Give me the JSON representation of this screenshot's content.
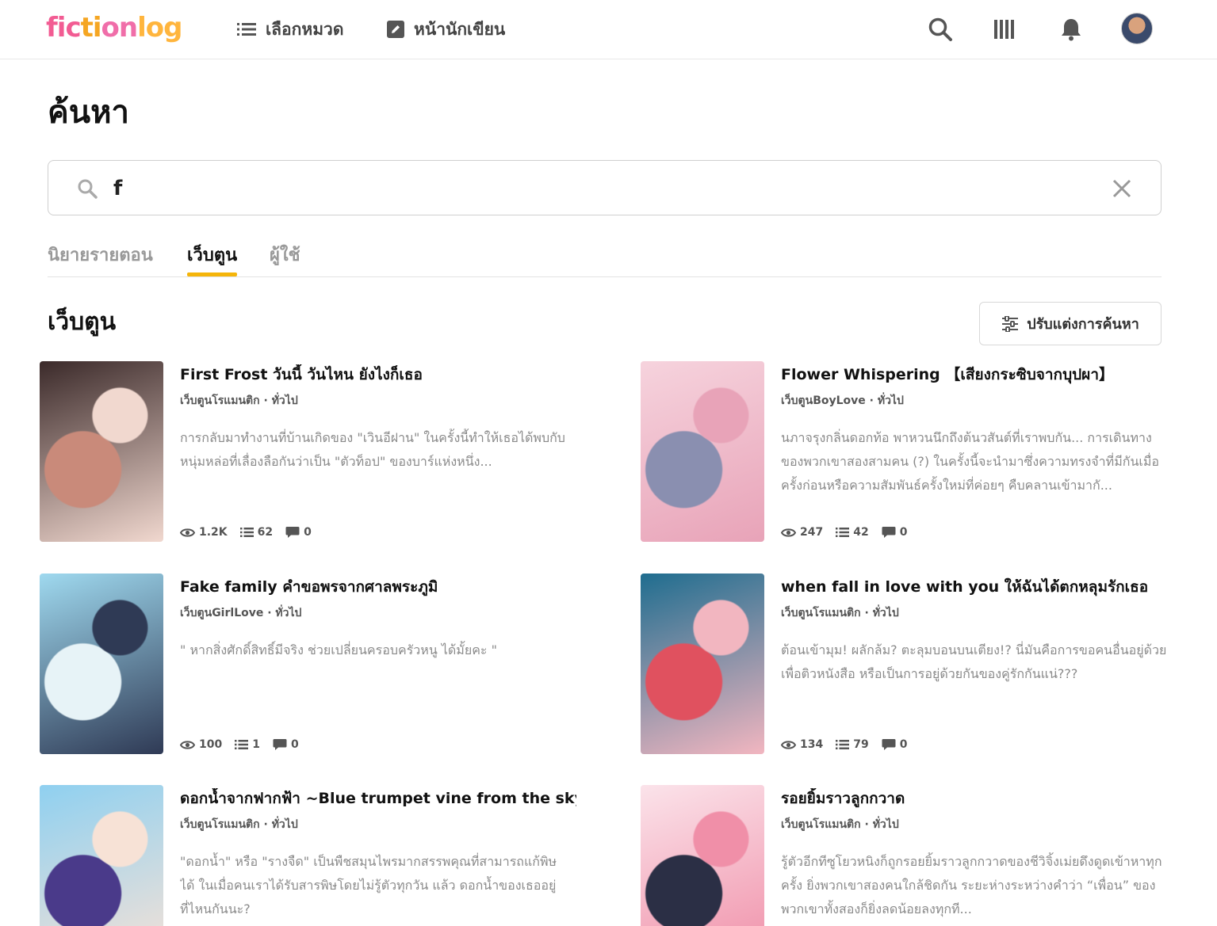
{
  "nav": {
    "logo": "fictionlog",
    "categories_label": "เลือกหมวด",
    "writer_label": "หน้านักเขียน"
  },
  "page": {
    "title": "ค้นหา"
  },
  "search": {
    "value": "f",
    "placeholder": ""
  },
  "tabs": [
    {
      "label": "นิยายรายตอน",
      "active": false
    },
    {
      "label": "เว็บตูน",
      "active": true
    },
    {
      "label": "ผู้ใช้",
      "active": false
    }
  ],
  "section": {
    "title": "เว็บตูน",
    "refine_label": "ปรับแต่งการค้นหา"
  },
  "results": [
    {
      "title": "First Frost วันนี้ วันไหน ยังไงก็เธอ",
      "genre": "เว็บตูนโรแมนติก · ทั่วไป",
      "description": "การกลับมาทำงานที่บ้านเกิดของ \"เวินอีฝาน\" ในครั้งนี้ทำให้เธอได้พบกับหนุ่มหล่อที่เลื่องลือกันว่าเป็น \"ตัวท็อป\" ของบาร์แห่งหนึ่ง...",
      "views": "1.2K",
      "chapters": "62",
      "comments": "0",
      "cover_colors": [
        "#3b2a2a",
        "#c98a7a",
        "#f1d8cf"
      ]
    },
    {
      "title": "Flower Whispering 【เสียงกระซิบจากบุปผา】",
      "genre": "เว็บตูนBoyLove · ทั่วไป",
      "description": "นภาจรุงกลิ่นดอกท้อ พาหวนนึกถึงต้นวสันต์ที่เราพบกัน... การเดินทางของพวกเขาสองสามคน (?) ในครั้งนี้จะนำมาซึ่งความทรงจำที่มีกันเมื่อครั้งก่อนหรือความสัมพันธ์ครั้งใหม่ที่ค่อยๆ คืบคลานเข้ามากั...",
      "views": "247",
      "chapters": "42",
      "comments": "0",
      "cover_colors": [
        "#f6d3dd",
        "#8a8fb0",
        "#e8a3b8"
      ]
    },
    {
      "title": "Fake family คำขอพรจากศาลพระภูมิ",
      "genre": "เว็บตูนGirlLove · ทั่วไป",
      "description": "\" หากสิ่งศักดิ์สิทธิ์มีจริง ช่วยเปลี่ยนครอบครัวหนู ได้มั้ยคะ \"",
      "views": "100",
      "chapters": "1",
      "comments": "0",
      "cover_colors": [
        "#9fd9ef",
        "#e7f3f7",
        "#2f3a55"
      ]
    },
    {
      "title": "when fall in love with you ให้ฉันได้ตกหลุมรักเธอ",
      "genre": "เว็บตูนโรแมนติก · ทั่วไป",
      "description": "ต้อนเข้ามุม! ผลักล้ม? ตะลุมบอนบนเตียง!? นี่มันคือการขอคนอื่นอยู่ด้วยเพื่อติวหนังสือ หรือเป็นการอยู่ด้วยกันของคู่รักกันแน่???",
      "views": "134",
      "chapters": "79",
      "comments": "0",
      "cover_colors": [
        "#1f6d8f",
        "#e0515f",
        "#f2b6c0"
      ]
    },
    {
      "title": "ดอกน้ำจากฟากฟ้า ~Blue trumpet vine from the sky~",
      "genre": "เว็บตูนโรแมนติก · ทั่วไป",
      "description": "\"ดอกน้ำ\" หรือ \"รางจืด\" เป็นพืชสมุนไพรมากสรรพคุณที่สามารถแก้พิษได้ ในเมื่อคนเราได้รับสารพิษโดยไม่รู้ตัวทุกวัน แล้ว ดอกน้ำของเธออยู่ที่ไหนกันนะ?",
      "views": "",
      "chapters": "",
      "comments": "",
      "cover_colors": [
        "#8fd0f0",
        "#4a3a8a",
        "#f7e2d6"
      ]
    },
    {
      "title": "รอยยิ้มราวลูกกวาด",
      "genre": "เว็บตูนโรแมนติก · ทั่วไป",
      "description": "รู้ตัวอีกทีซูโยวหนิงก็ถูกรอยยิ้มราวลูกกวาดของชีวิจิ้งเม่ยดึงดูดเข้าหาทุกครั้ง ยิ่งพวกเขาสองคนใกล้ชิดกัน ระยะห่างระหว่างคำว่า “เพื่อน” ของพวกเขาทั้งสองก็ยิ่งลดน้อยลงทุกที...",
      "views": "",
      "chapters": "",
      "comments": "",
      "cover_colors": [
        "#fbe3ea",
        "#2b2f45",
        "#f08fa8"
      ]
    }
  ]
}
